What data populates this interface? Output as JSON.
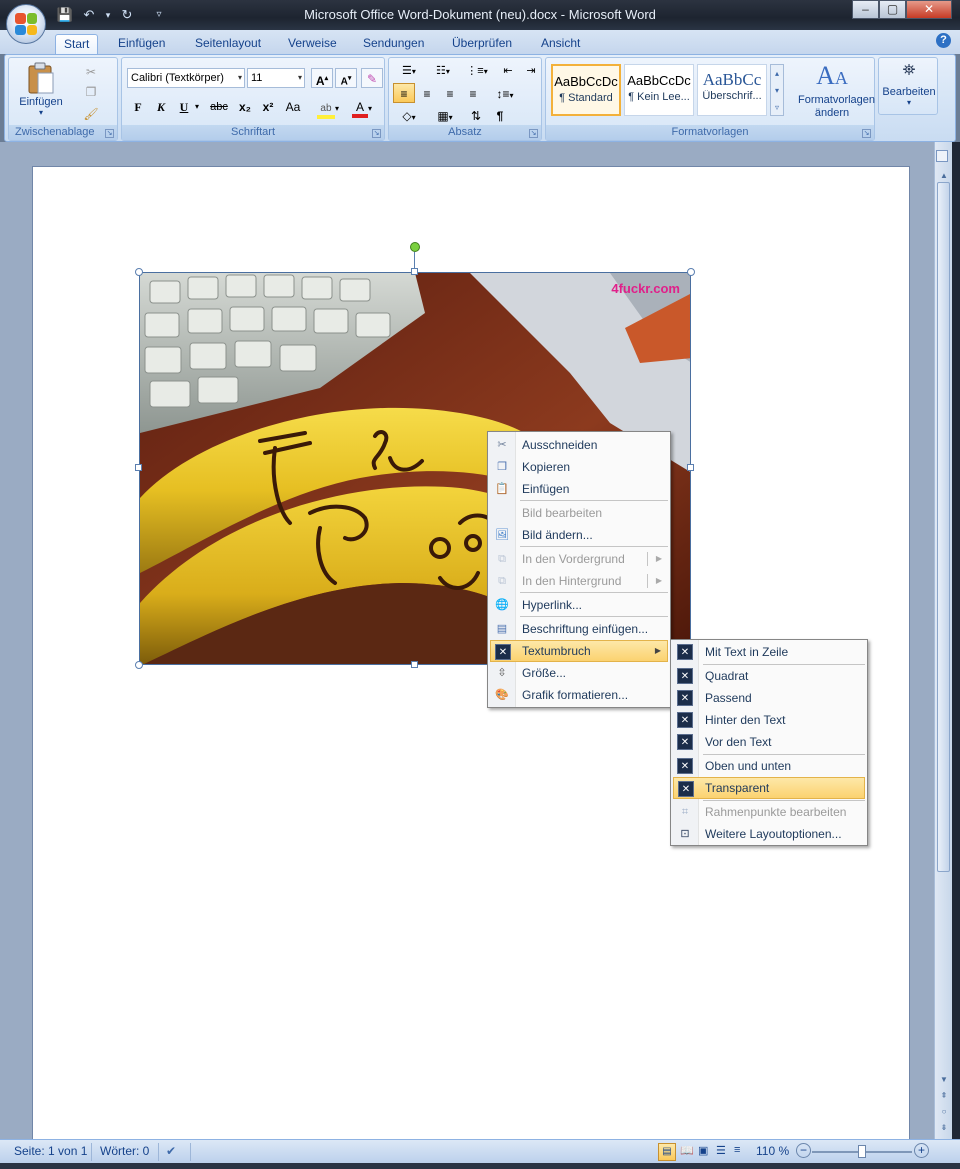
{
  "window": {
    "title": "Microsoft Office Word-Dokument (neu).docx - Microsoft Word",
    "minimize": "–",
    "maximize": "▢",
    "close": "✕"
  },
  "qat": {
    "save": "💾",
    "undo": "↶",
    "undo_drop": "▾",
    "redo": "↻",
    "customize": "▿"
  },
  "tabs": [
    "Start",
    "Einfügen",
    "Seitenlayout",
    "Verweise",
    "Sendungen",
    "Überprüfen",
    "Ansicht"
  ],
  "active_tab": "Start",
  "help": "?",
  "ribbon": {
    "clipboard": {
      "label": "Zwischenablage",
      "paste": "Einfügen"
    },
    "font": {
      "label": "Schriftart",
      "font_name": "Calibri (Textkörper)",
      "font_size": "11",
      "grow": "A",
      "shrink": "A",
      "bold": "F",
      "italic": "K",
      "underline": "U",
      "strike": "abc",
      "subscript": "x₂",
      "superscript": "x²",
      "case": "Aa"
    },
    "paragraph": {
      "label": "Absatz",
      "pilcrow": "¶"
    },
    "styles": {
      "label": "Formatvorlagen",
      "items": [
        {
          "sample": "AaBbCcDc",
          "name": "¶ Standard"
        },
        {
          "sample": "AaBbCcDc",
          "name": "¶ Kein Lee..."
        },
        {
          "sample": "AaBbCc",
          "name": "Überschrif..."
        }
      ],
      "change_styles": "Formatvorlagen ändern",
      "change_arrow": "▾"
    },
    "editing": {
      "label": "Bearbeiten",
      "arrow": "▾"
    }
  },
  "picture": {
    "watermark": "4fuckr.com"
  },
  "context_menu": {
    "items": [
      {
        "label": "Ausschneiden",
        "enabled": true,
        "icon": "scissors-icon"
      },
      {
        "label": "Kopieren",
        "enabled": true,
        "icon": "copy-icon"
      },
      {
        "label": "Einfügen",
        "enabled": true,
        "icon": "paste-icon"
      },
      {
        "label": "Bild bearbeiten",
        "enabled": false,
        "icon": ""
      },
      {
        "label": "Bild ändern...",
        "enabled": true,
        "icon": "change-picture-icon"
      },
      {
        "label": "In den Vordergrund",
        "enabled": false,
        "icon": "bring-forward-icon",
        "submenu": true
      },
      {
        "label": "In den Hintergrund",
        "enabled": false,
        "icon": "send-backward-icon",
        "submenu": true
      },
      {
        "label": "Hyperlink...",
        "enabled": true,
        "icon": "hyperlink-icon"
      },
      {
        "label": "Beschriftung einfügen...",
        "enabled": true,
        "icon": "caption-icon"
      },
      {
        "label": "Textumbruch",
        "enabled": true,
        "icon": "text-wrap-icon",
        "submenu": true,
        "highlighted": true
      },
      {
        "label": "Größe...",
        "enabled": true,
        "icon": "size-icon"
      },
      {
        "label": "Grafik formatieren...",
        "enabled": true,
        "icon": "format-picture-icon"
      }
    ]
  },
  "submenu": {
    "items": [
      {
        "label": "Mit Text in Zeile",
        "enabled": true
      },
      {
        "label": "Quadrat",
        "enabled": true
      },
      {
        "label": "Passend",
        "enabled": true
      },
      {
        "label": "Hinter den Text",
        "enabled": true
      },
      {
        "label": "Vor den Text",
        "enabled": true
      },
      {
        "label": "Oben und unten",
        "enabled": true
      },
      {
        "label": "Transparent",
        "enabled": true,
        "highlighted": true
      },
      {
        "label": "Rahmenpunkte bearbeiten",
        "enabled": false
      },
      {
        "label": "Weitere Layoutoptionen...",
        "enabled": true
      }
    ]
  },
  "status": {
    "page": "Seite: 1 von 1",
    "words": "Wörter: 0",
    "zoom": "110 %",
    "zoom_out": "−",
    "zoom_in": "+"
  },
  "colors": {
    "accent": "#15428b",
    "highlight_yellow": "#fbd270",
    "font_color_red": "#e02020"
  }
}
